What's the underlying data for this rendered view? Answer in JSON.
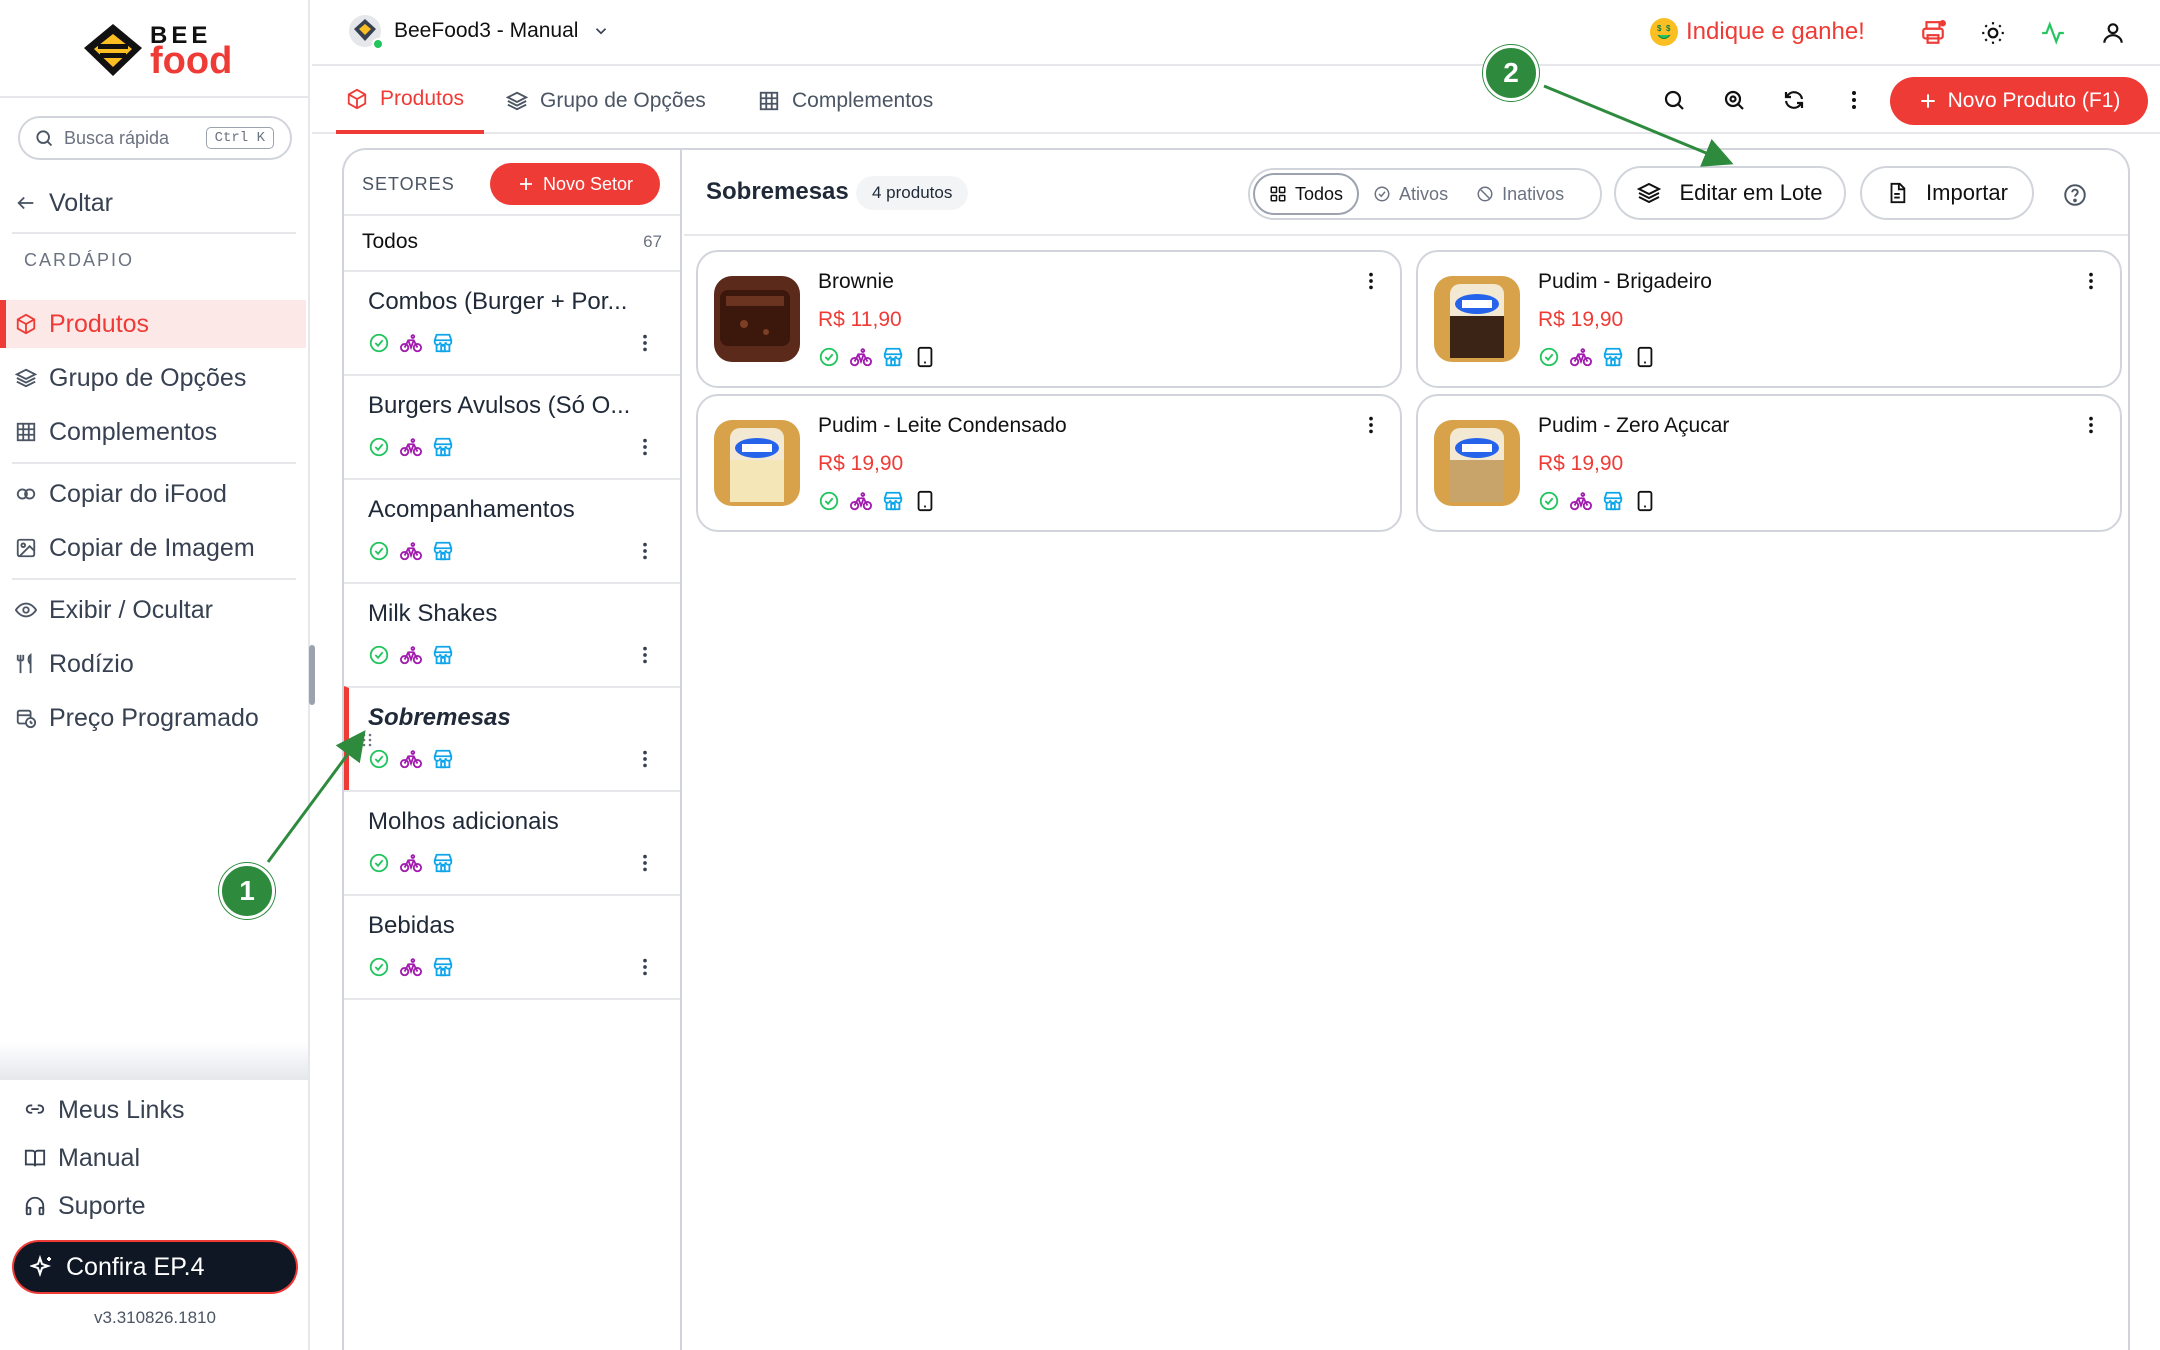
{
  "brand": {
    "logo_top": "BEE",
    "logo_bottom": "food"
  },
  "sidebar": {
    "search_placeholder": "Busca rápida",
    "search_shortcut": "Ctrl K",
    "back_label": "Voltar",
    "section_heading": "CARDÁPIO",
    "items": [
      {
        "label": "Produtos",
        "icon": "box-icon",
        "active": true
      },
      {
        "label": "Grupo de Opções",
        "icon": "layers-icon"
      },
      {
        "label": "Complementos",
        "icon": "grid-icon"
      },
      {
        "label": "Copiar do iFood",
        "icon": "copy-icon"
      },
      {
        "label": "Copiar de Imagem",
        "icon": "image-edit-icon"
      },
      {
        "label": "Exibir / Ocultar",
        "icon": "eye-icon"
      },
      {
        "label": "Rodízio",
        "icon": "utensils-icon"
      },
      {
        "label": "Preço Programado",
        "icon": "calendar-clock-icon"
      }
    ],
    "bottom_items": [
      {
        "label": "Meus Links",
        "icon": "link-icon"
      },
      {
        "label": "Manual",
        "icon": "book-icon"
      },
      {
        "label": "Suporte",
        "icon": "headphones-icon"
      }
    ],
    "promo_label": "Confira EP.4",
    "version": "v3.310826.1810"
  },
  "topbar": {
    "store_name": "BeeFood3 - Manual",
    "referral_label": "Indique e ganhe!"
  },
  "tabs": [
    {
      "label": "Produtos",
      "icon": "box-icon",
      "active": true
    },
    {
      "label": "Grupo de Opções",
      "icon": "layers-icon"
    },
    {
      "label": "Complementos",
      "icon": "grid-icon"
    }
  ],
  "toolbar": {
    "new_product_label": "Novo Produto (F1)"
  },
  "sectors": {
    "heading": "SETORES",
    "new_label": "Novo Setor",
    "all_label": "Todos",
    "all_count": "67",
    "list": [
      {
        "name": "Combos (Burger + Por..."
      },
      {
        "name": "Burgers Avulsos (Só O..."
      },
      {
        "name": "Acompanhamentos"
      },
      {
        "name": "Milk Shakes"
      },
      {
        "name": "Sobremesas",
        "active": true
      },
      {
        "name": "Molhos adicionais"
      },
      {
        "name": "Bebidas"
      }
    ]
  },
  "content": {
    "title": "Sobremesas",
    "count_badge": "4 produtos",
    "filters": [
      {
        "label": "Todos",
        "icon": "grid-icon",
        "active": true
      },
      {
        "label": "Ativos",
        "icon": "check-circle-icon"
      },
      {
        "label": "Inativos",
        "icon": "ban-icon"
      }
    ],
    "batch_edit_label": "Editar em Lote",
    "import_label": "Importar"
  },
  "products": [
    {
      "name": "Brownie",
      "price": "R$ 11,90"
    },
    {
      "name": "Pudim - Brigadeiro",
      "price": "R$ 19,90"
    },
    {
      "name": "Pudim - Leite Condensado",
      "price": "R$ 19,90"
    },
    {
      "name": "Pudim - Zero Açucar",
      "price": "R$ 19,90"
    }
  ],
  "annotations": [
    "1",
    "2"
  ],
  "colors": {
    "accent": "#ef3b36",
    "active_bg": "#fde8e8",
    "status_green": "#22c55e",
    "delivery_purple": "#a21caf",
    "store_blue": "#0ea5e9",
    "annotation_green": "#2e8b3e"
  }
}
